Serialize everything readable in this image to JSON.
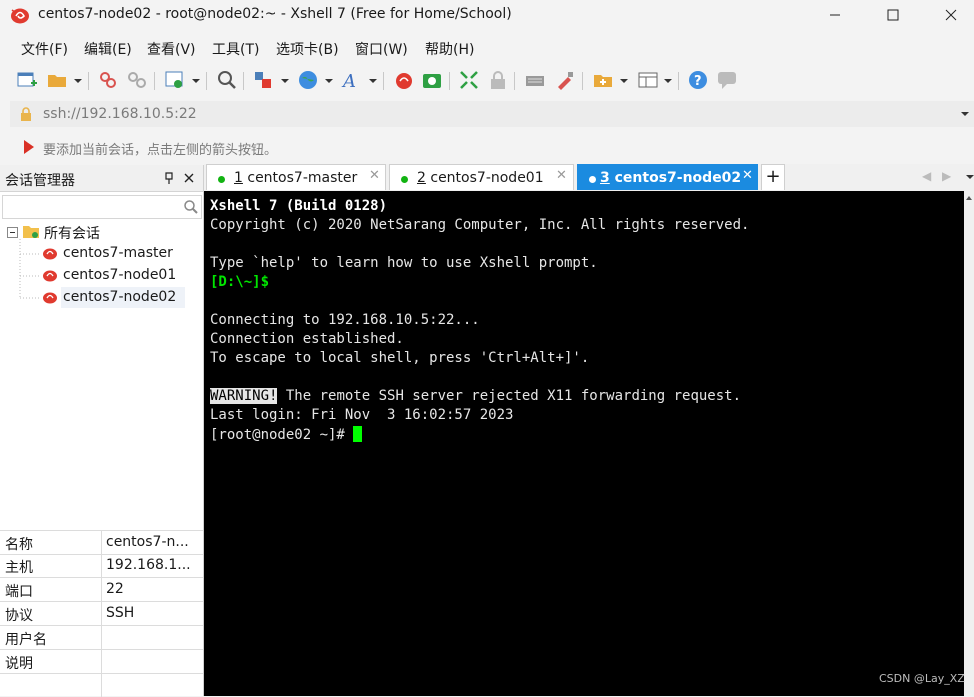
{
  "window": {
    "title": "centos7-node02 - root@node02:~ - Xshell 7 (Free for Home/School)"
  },
  "menu": [
    "文件(F)",
    "编辑(E)",
    "查看(V)",
    "工具(T)",
    "选项卡(B)",
    "窗口(W)",
    "帮助(H)"
  ],
  "toolbar": {
    "icons": [
      "new-session-icon",
      "open-folder-icon",
      "reconnect-icon",
      "disconnect-icon",
      "properties-icon",
      "search-icon",
      "transfer-icon",
      "globe-icon",
      "font-icon",
      "xshell-icon",
      "xftp-icon",
      "fullscreen-icon",
      "lock-icon",
      "keyboard-icon",
      "highlight-icon",
      "new-window-icon",
      "layout-icon",
      "help-icon",
      "chat-icon"
    ]
  },
  "address": {
    "value": "ssh://192.168.10.5:22"
  },
  "hint": {
    "text": "要添加当前会话，点击左侧的箭头按钮。"
  },
  "session_manager": {
    "title": "会话管理器",
    "root": "所有会话",
    "sessions": [
      "centos7-master",
      "centos7-node01",
      "centos7-node02"
    ]
  },
  "properties": [
    {
      "key": "名称",
      "value": "centos7-n..."
    },
    {
      "key": "主机",
      "value": "192.168.1..."
    },
    {
      "key": "端口",
      "value": "22"
    },
    {
      "key": "协议",
      "value": "SSH"
    },
    {
      "key": "用户名",
      "value": ""
    },
    {
      "key": "说明",
      "value": ""
    }
  ],
  "tabs": [
    {
      "num": "1",
      "label": "centos7-master"
    },
    {
      "num": "2",
      "label": "centos7-node01"
    },
    {
      "num": "3",
      "label": "centos7-node02"
    }
  ],
  "terminal": {
    "lines": [
      "Xshell 7 (Build 0128)",
      "Copyright (c) 2020 NetSarang Computer, Inc. All rights reserved.",
      "",
      "Type `help' to learn how to use Xshell prompt.",
      "[D:\\~]$",
      "",
      "Connecting to 192.168.10.5:22...",
      "Connection established.",
      "To escape to local shell, press 'Ctrl+Alt+]'.",
      "",
      "WARNING!",
      " The remote SSH server rejected X11 forwarding request.",
      "Last login: Fri Nov  3 16:02:57 2023",
      "[root@node02 ~]# "
    ]
  },
  "colors": {
    "accent": "#1b8be0",
    "terminal_bg": "#000000",
    "prompt_green": "#00ff00",
    "dot_green": "#12b312"
  },
  "watermark": "CSDN @Lay_XZ"
}
